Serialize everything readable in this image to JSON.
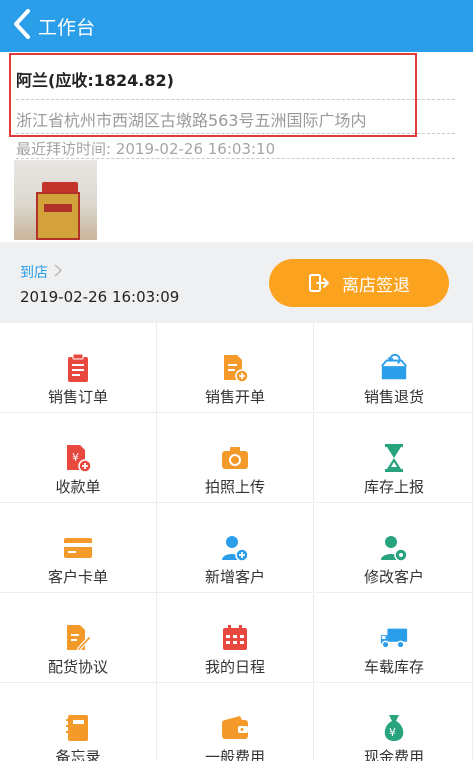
{
  "header": {
    "title": "工作台"
  },
  "customer": {
    "name": "阿兰(应收:1824.82)",
    "address": "浙江省杭州市西湖区古墩路563号五洲国际广场内",
    "last_visit": "最近拜访时间: 2019-02-26 16:03:10"
  },
  "checkin": {
    "arrive_label": "到店",
    "arrive_time": "2019-02-26 16:03:09",
    "leave_button": "离店签退"
  },
  "menu": [
    {
      "label": "销售订单",
      "icon": "sales-order-icon",
      "color": "#e8483d"
    },
    {
      "label": "销售开单",
      "icon": "sales-invoice-icon",
      "color": "#f39a2a"
    },
    {
      "label": "销售退货",
      "icon": "sales-return-icon",
      "color": "#2a9ee8"
    },
    {
      "label": "收款单",
      "icon": "receipt-icon",
      "color": "#e8483d"
    },
    {
      "label": "拍照上传",
      "icon": "camera-icon",
      "color": "#f39a2a"
    },
    {
      "label": "库存上报",
      "icon": "hourglass-icon",
      "color": "#27a37d"
    },
    {
      "label": "客户卡单",
      "icon": "card-icon",
      "color": "#f39a2a"
    },
    {
      "label": "新增客户",
      "icon": "add-user-icon",
      "color": "#2a9ee8"
    },
    {
      "label": "修改客户",
      "icon": "edit-user-icon",
      "color": "#27a37d"
    },
    {
      "label": "配货协议",
      "icon": "agreement-icon",
      "color": "#f39a2a"
    },
    {
      "label": "我的日程",
      "icon": "calendar-icon",
      "color": "#e8483d"
    },
    {
      "label": "车载库存",
      "icon": "truck-icon",
      "color": "#2a9ee8"
    },
    {
      "label": "备忘录",
      "icon": "memo-icon",
      "color": "#f39a2a"
    },
    {
      "label": "一般费用",
      "icon": "wallet-icon",
      "color": "#f39a2a"
    },
    {
      "label": "现金费用",
      "icon": "money-bag-icon",
      "color": "#27a37d"
    }
  ]
}
